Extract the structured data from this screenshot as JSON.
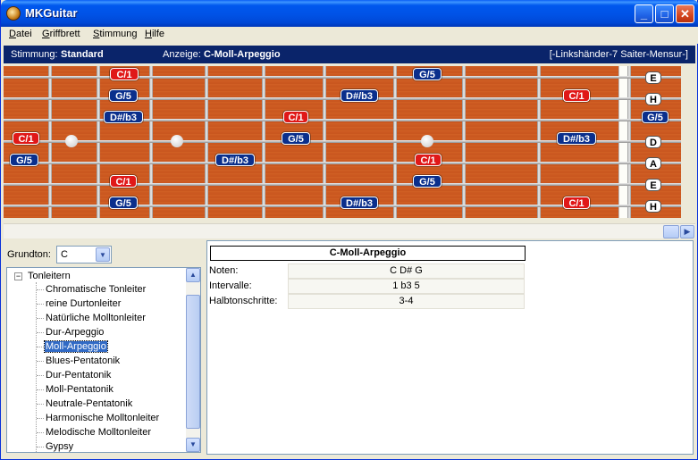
{
  "window": {
    "title": "MKGuitar"
  },
  "menu": [
    "Datei",
    "Griffbrett",
    "Stimmung",
    "Hilfe"
  ],
  "menu_accel": [
    "D",
    "G",
    "S",
    "H"
  ],
  "infobar": {
    "tuning_label": "Stimmung:",
    "tuning_value": "Standard",
    "display_label": "Anzeige:",
    "display_value": "C-Moll-Arpeggio",
    "mode": "[-Linkshänder-7 Saiter-Mensur-]"
  },
  "strings": [
    "E",
    "H",
    "G",
    "D",
    "A",
    "E",
    "H"
  ],
  "notes": [
    {
      "string": 0,
      "fret": "n1",
      "label": "C/1",
      "root": true
    },
    {
      "string": 0,
      "fret": "n2",
      "label": "G/5",
      "root": false
    },
    {
      "string": 1,
      "fret": "n3",
      "label": "G/5",
      "root": false
    },
    {
      "string": 1,
      "fret": "n4",
      "label": "D#/b3",
      "root": false
    },
    {
      "string": 1,
      "fret": "n5",
      "label": "C/1",
      "root": true
    },
    {
      "string": 2,
      "fret": "n6",
      "label": "D#/b3",
      "root": false
    },
    {
      "string": 2,
      "fret": "n7",
      "label": "C/1",
      "root": true
    },
    {
      "string": 2,
      "fret": "n8",
      "label": "G/5",
      "root": false
    },
    {
      "string": 3,
      "fret": "n9",
      "label": "C/1",
      "root": true
    },
    {
      "string": 3,
      "fret": "n10",
      "label": "G/5",
      "root": false
    },
    {
      "string": 3,
      "fret": "n11",
      "label": "D#/b3",
      "root": false
    },
    {
      "string": 4,
      "fret": "n12",
      "label": "G/5",
      "root": false
    },
    {
      "string": 4,
      "fret": "n13",
      "label": "D#/b3",
      "root": false
    },
    {
      "string": 4,
      "fret": "n14",
      "label": "C/1",
      "root": true
    },
    {
      "string": 5,
      "fret": "n15",
      "label": "C/1",
      "root": true
    },
    {
      "string": 5,
      "fret": "n16",
      "label": "G/5",
      "root": false
    },
    {
      "string": 6,
      "fret": "n17",
      "label": "G/5",
      "root": false
    },
    {
      "string": 6,
      "fret": "n18",
      "label": "D#/b3",
      "root": false
    },
    {
      "string": 6,
      "fret": "n19",
      "label": "C/1",
      "root": true
    }
  ],
  "grundton": {
    "label": "Grundton:",
    "value": "C"
  },
  "tree": {
    "root": "Tonleitern",
    "items": [
      "Chromatische Tonleiter",
      "reine Durtonleiter",
      "Natürliche Molltonleiter",
      "Dur-Arpeggio",
      "Moll-Arpeggio",
      "Blues-Pentatonik",
      "Dur-Pentatonik",
      "Moll-Pentatonik",
      "Neutrale-Pentatonik",
      "Harmonische Molltonleiter",
      "Melodische Molltonleiter",
      "Gypsy"
    ],
    "selected": "Moll-Arpeggio"
  },
  "details": {
    "title": "C-Moll-Arpeggio",
    "rows": [
      {
        "label": "Noten:",
        "value": "C D# G"
      },
      {
        "label": "Intervalle:",
        "value": "1 b3 5"
      },
      {
        "label": "Halbtonschritte:",
        "value": "3-4"
      }
    ]
  },
  "colors": {
    "root": "#e01818",
    "other": "#0a2f8c",
    "wood": "#c9581e",
    "titlebar": "#0052e6"
  }
}
